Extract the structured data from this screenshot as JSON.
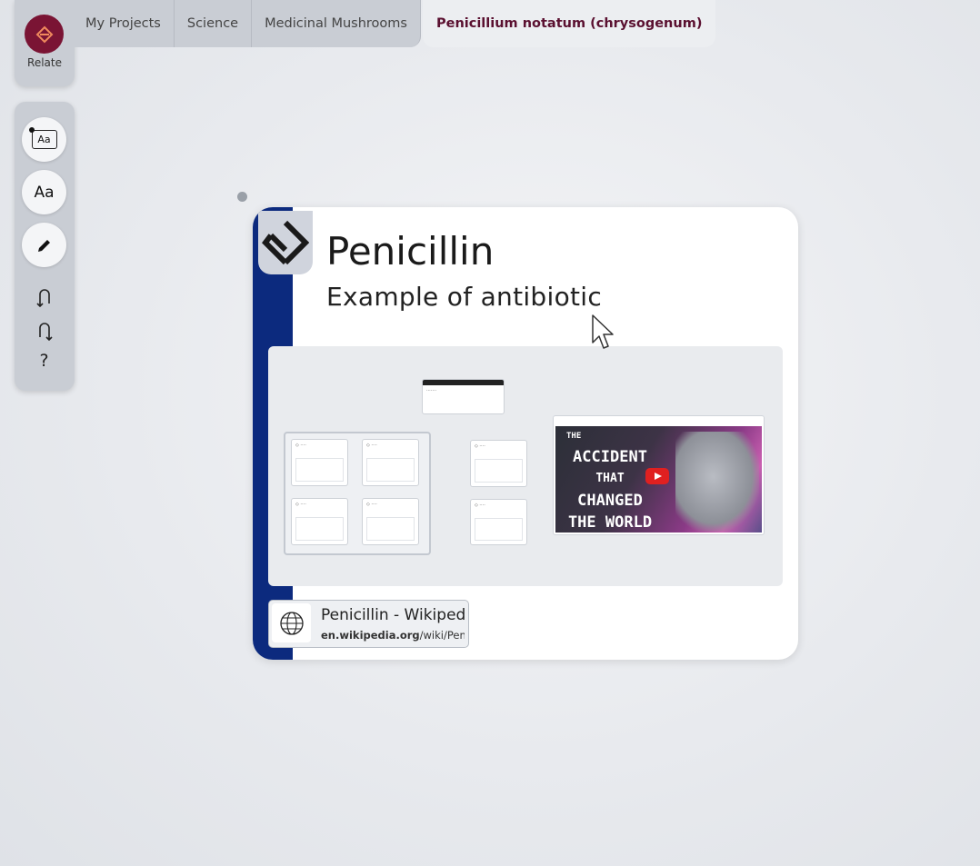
{
  "app": {
    "name": "Relate",
    "accent": "#7a1434",
    "card_bar_color": "#0c2a7e"
  },
  "breadcrumbs": [
    "My Projects",
    "Science",
    "Medicinal Mushrooms",
    "Penicillium notatum (chrysogenum)"
  ],
  "toolbar": {
    "tools": [
      {
        "icon": "text-box-icon",
        "label": "Aa"
      },
      {
        "icon": "text-style-icon",
        "label": "Aa"
      },
      {
        "icon": "pencil-icon"
      },
      {
        "icon": "undo-icon"
      },
      {
        "icon": "redo-icon"
      },
      {
        "icon": "help-icon",
        "label": "?"
      }
    ]
  },
  "card": {
    "title": "Penicillin",
    "subtitle": "Example  of antibiotic",
    "link": {
      "title": "Penicillin - Wikipedia",
      "domain": "en.wikipedia.org",
      "path": "/wiki/Penicillin"
    },
    "video": {
      "headline": [
        "ACCIDENT",
        "THAT",
        "CHANGED",
        "THE WORLD"
      ],
      "pre": "THE"
    }
  }
}
